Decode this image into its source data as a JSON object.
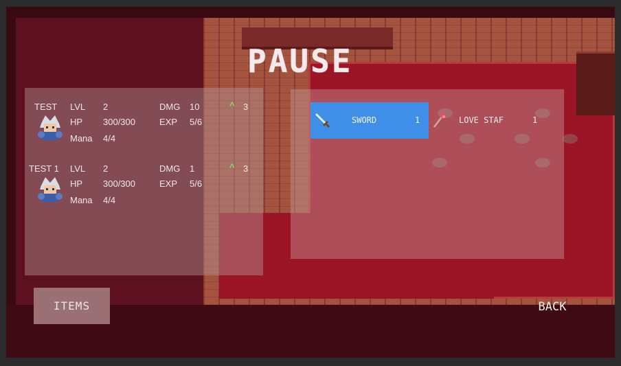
{
  "screen": {
    "title": "PAUSE"
  },
  "party": [
    {
      "name": "TEST",
      "lvl_label": "LVL",
      "lvl": "2",
      "dmg_label": "DMG",
      "dmg": "10",
      "hp_label": "HP",
      "hp": "300/300",
      "exp_label": "EXP",
      "exp": "5/6",
      "mana_label": "Mana",
      "mana": "4/4",
      "skill_points": "3"
    },
    {
      "name": "TEST 1",
      "lvl_label": "LVL",
      "lvl": "2",
      "dmg_label": "DMG",
      "dmg": "1",
      "hp_label": "HP",
      "hp": "300/300",
      "exp_label": "EXP",
      "exp": "5/6",
      "mana_label": "Mana",
      "mana": "4/4",
      "skill_points": "3"
    }
  ],
  "inventory": [
    {
      "name": "SWORD",
      "count": "1",
      "icon": "sword-icon",
      "selected": true
    },
    {
      "name": "LOVE STAF",
      "count": "1",
      "icon": "staff-icon",
      "selected": false
    }
  ],
  "buttons": {
    "items": "ITEMS",
    "back": "BACK"
  },
  "colors": {
    "selected": "#3f8fe8",
    "levelup": "#7fe06a",
    "background": "#3a0a12"
  }
}
